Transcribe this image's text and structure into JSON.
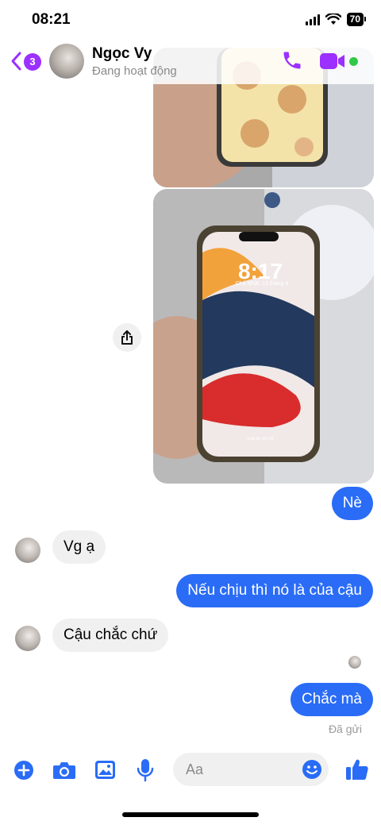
{
  "status_bar": {
    "time": "08:21",
    "battery": "70"
  },
  "header": {
    "unread_count": "3",
    "contact_name": "Ngọc Vy",
    "contact_status": "Đang hoạt động"
  },
  "lock_screen": {
    "time": "8:17",
    "date": "Chủ Nhật, 13 tháng 8",
    "hint": "Vuốt lên để mở"
  },
  "messages": [
    {
      "dir": "out",
      "text": "Nè"
    },
    {
      "dir": "in",
      "text": "Vg ạ"
    },
    {
      "dir": "out",
      "text": "Nếu chịu thì nó là của cậu"
    },
    {
      "dir": "in",
      "text": "Cậu chắc chứ"
    },
    {
      "dir": "out",
      "text": "Chắc mà"
    }
  ],
  "sent_status": "Đã gửi",
  "composer": {
    "placeholder": "Aa"
  },
  "colors": {
    "accent": "#2a6cf6",
    "header_purple": "#9b30ff",
    "online": "#31c84a"
  },
  "icons": [
    "back-chevron-icon",
    "phone-icon",
    "video-camera-icon",
    "share-icon",
    "plus-icon",
    "camera-icon",
    "gallery-icon",
    "microphone-icon",
    "emoji-icon",
    "thumbs-up-icon"
  ]
}
